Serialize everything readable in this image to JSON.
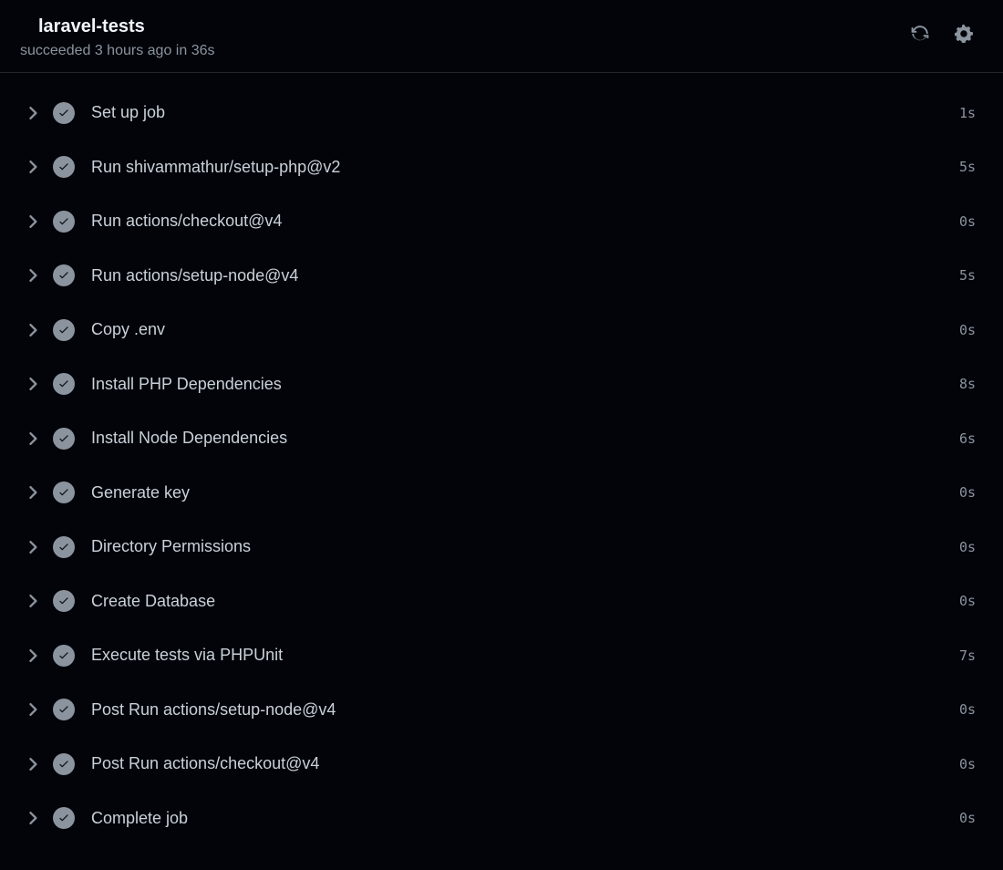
{
  "header": {
    "title": "laravel-tests",
    "status": "succeeded 3 hours ago in 36s"
  },
  "steps": [
    {
      "label": "Set up job",
      "duration": "1s"
    },
    {
      "label": "Run shivammathur/setup-php@v2",
      "duration": "5s"
    },
    {
      "label": "Run actions/checkout@v4",
      "duration": "0s"
    },
    {
      "label": "Run actions/setup-node@v4",
      "duration": "5s"
    },
    {
      "label": "Copy .env",
      "duration": "0s"
    },
    {
      "label": "Install PHP Dependencies",
      "duration": "8s"
    },
    {
      "label": "Install Node Dependencies",
      "duration": "6s"
    },
    {
      "label": "Generate key",
      "duration": "0s"
    },
    {
      "label": "Directory Permissions",
      "duration": "0s"
    },
    {
      "label": "Create Database",
      "duration": "0s"
    },
    {
      "label": "Execute tests via PHPUnit",
      "duration": "7s"
    },
    {
      "label": "Post Run actions/setup-node@v4",
      "duration": "0s"
    },
    {
      "label": "Post Run actions/checkout@v4",
      "duration": "0s"
    },
    {
      "label": "Complete job",
      "duration": "0s"
    }
  ]
}
